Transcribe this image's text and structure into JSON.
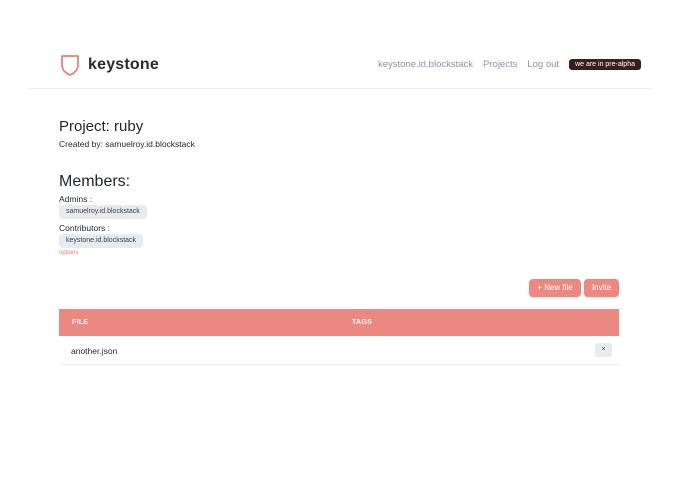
{
  "header": {
    "brand": "keystone",
    "nav": [
      "keystone.id.blockstack",
      "Projects",
      "Log out"
    ],
    "badge": "we are in pre-alpha"
  },
  "project": {
    "title": "Project: ruby",
    "created_by": "Created by: samuelroy.id.blockstack"
  },
  "members": {
    "heading": "Members:",
    "admins_label": "Admins :",
    "admins": [
      "samuelroy.id.blockstack"
    ],
    "contributors_label": "Contributors :",
    "contributors": [
      "keystone.id.blockstack"
    ],
    "options_label": "options"
  },
  "actions": {
    "new_file": "+ New file",
    "invite": "Invite"
  },
  "table": {
    "columns": [
      "FILE",
      "TAGS"
    ],
    "rows": [
      {
        "file": "another.json",
        "tags": "",
        "delete": "×"
      }
    ]
  },
  "colors": {
    "accent": "#ec8882",
    "badge_bg": "#3a1e1e",
    "chip_bg": "#e7eaf0"
  }
}
